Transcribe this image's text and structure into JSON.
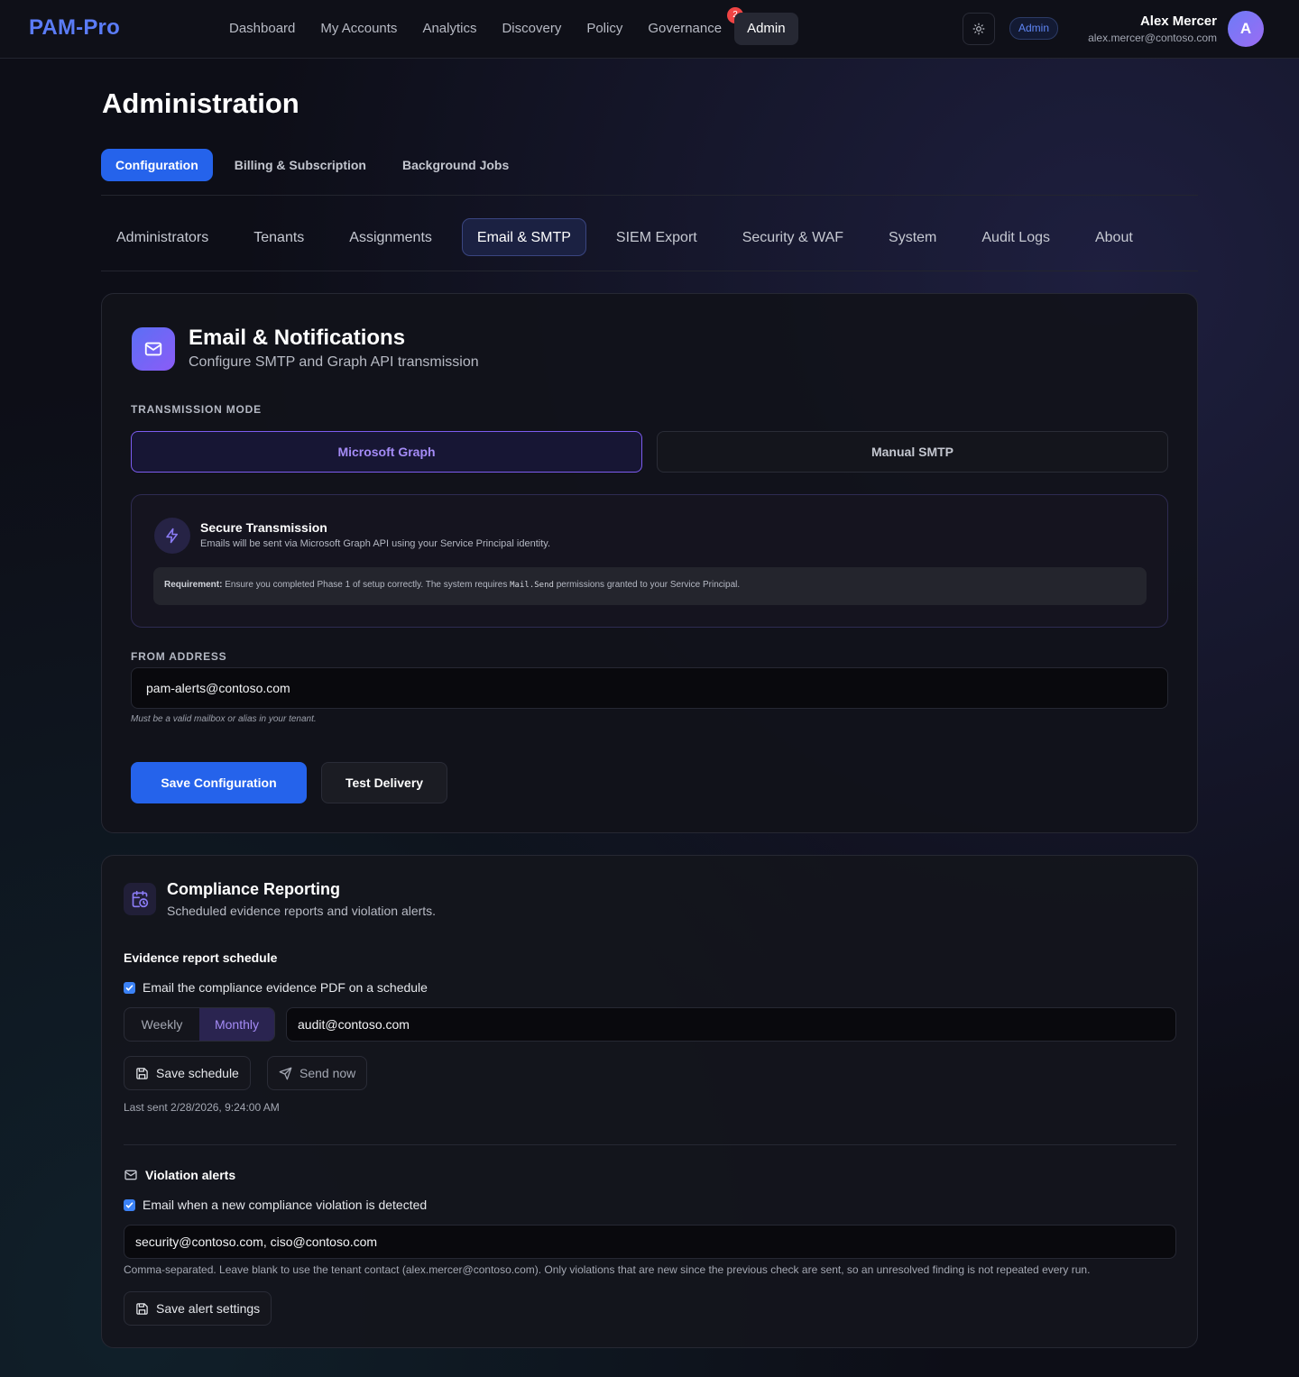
{
  "app": {
    "logo": "PAM-Pro",
    "nav": [
      {
        "label": "Dashboard",
        "active": false
      },
      {
        "label": "My Accounts",
        "active": false
      },
      {
        "label": "Analytics",
        "active": false
      },
      {
        "label": "Discovery",
        "active": false
      },
      {
        "label": "Policy",
        "active": false
      },
      {
        "label": "Governance",
        "active": false,
        "badge": "2"
      },
      {
        "label": "Admin",
        "active": true
      }
    ],
    "theme_icon": "sun-icon",
    "role_badge": "Admin",
    "user": {
      "name": "Alex Mercer",
      "email": "alex.mercer@contoso.com",
      "initial": "A"
    }
  },
  "page": {
    "title": "Administration",
    "main_tabs": [
      {
        "label": "Configuration",
        "active": true
      },
      {
        "label": "Billing & Subscription",
        "active": false
      },
      {
        "label": "Background Jobs",
        "active": false
      }
    ],
    "sub_tabs": [
      {
        "label": "Administrators",
        "active": false
      },
      {
        "label": "Tenants",
        "active": false
      },
      {
        "label": "Assignments",
        "active": false
      },
      {
        "label": "Email & SMTP",
        "active": true
      },
      {
        "label": "SIEM Export",
        "active": false
      },
      {
        "label": "Security & WAF",
        "active": false
      },
      {
        "label": "System",
        "active": false
      },
      {
        "label": "Audit Logs",
        "active": false
      },
      {
        "label": "About",
        "active": false
      }
    ]
  },
  "email_card": {
    "icon": "mail-icon",
    "title": "Email & Notifications",
    "subtitle": "Configure SMTP and Graph API transmission",
    "mode_label": "TRANSMISSION MODE",
    "modes": [
      {
        "label": "Microsoft Graph",
        "selected": true
      },
      {
        "label": "Manual SMTP",
        "selected": false
      }
    ],
    "info": {
      "icon": "lightning-icon",
      "title": "Secure Transmission",
      "text": "Emails will be sent via Microsoft Graph API using your Service Principal identity.",
      "req_label": "Requirement:",
      "req_text_1": "Ensure you completed Phase 1 of setup correctly. The system requires",
      "req_code": "Mail.Send",
      "req_text_2": "permissions granted to your Service Principal."
    },
    "from_label": "FROM ADDRESS",
    "from_value": "pam-alerts@contoso.com",
    "from_hint": "Must be a valid mailbox or alias in your tenant.",
    "save_label": "Save Configuration",
    "test_label": "Test Delivery"
  },
  "compliance_card": {
    "icon": "calendar-clock-icon",
    "title": "Compliance Reporting",
    "subtitle": "Scheduled evidence reports and violation alerts.",
    "schedule_heading": "Evidence report schedule",
    "schedule_checkbox": "Email the compliance evidence PDF on a schedule",
    "schedule_checked": true,
    "frequency": [
      {
        "label": "Weekly",
        "active": false
      },
      {
        "label": "Monthly",
        "active": true
      }
    ],
    "schedule_recipients": "audit@contoso.com",
    "save_schedule_label": "Save schedule",
    "send_now_label": "Send now",
    "last_sent": "Last sent 2/28/2026, 9:24:00 AM",
    "violations_heading": "Violation alerts",
    "violations_checkbox": "Email when a new compliance violation is detected",
    "violations_checked": true,
    "violation_recipients": "security@contoso.com, ciso@contoso.com",
    "violation_hint": "Comma-separated. Leave blank to use the tenant contact (alex.mercer@contoso.com). Only violations that are new since the previous check are sent, so an unresolved finding is not repeated every run.",
    "save_alert_label": "Save alert settings"
  },
  "colors": {
    "accent": "#2563eb",
    "purple": "#8b5cf6",
    "background": "#0d0e17"
  }
}
